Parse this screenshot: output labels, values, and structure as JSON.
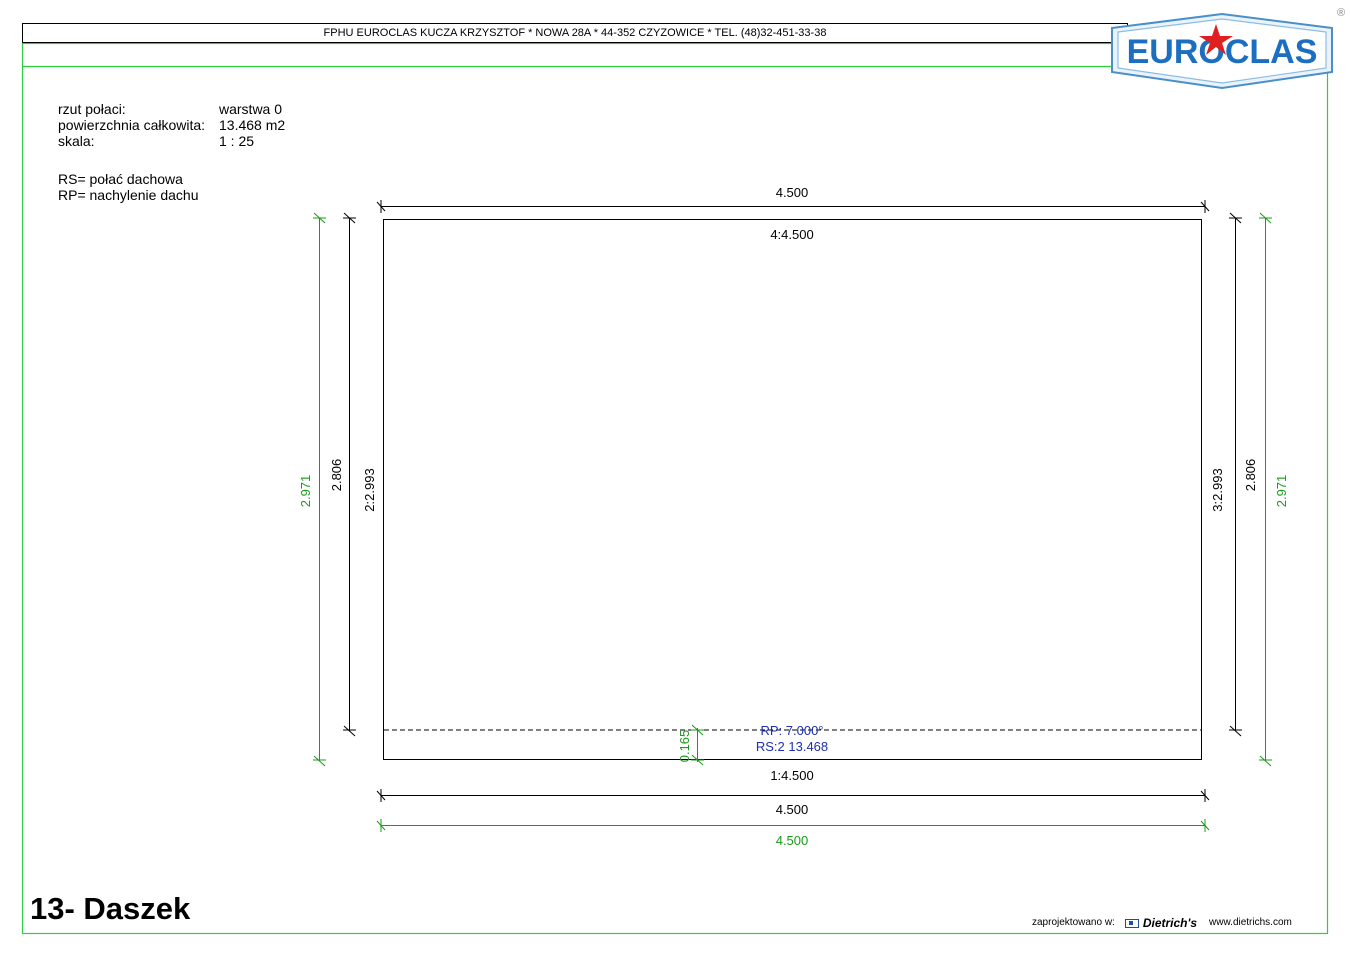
{
  "header": {
    "company_line": "FPHU EUROCLAS KUCZA KRZYSZTOF * NOWA 28A * 44-352 CZYZOWICE * TEL. (48)32-451-33-38",
    "logo_text": "EUROCLAS",
    "registered_mark": "®"
  },
  "info": {
    "rows": [
      {
        "label": "rzut połaci:",
        "value": "warstwa 0"
      },
      {
        "label": "powierzchnia całkowita:",
        "value": "13.468 m2"
      },
      {
        "label": "skala:",
        "value": "1 : 25"
      }
    ]
  },
  "legend": {
    "rs": "RS= połać dachowa",
    "rp": "RP= nachylenie dachu"
  },
  "drawing": {
    "dim_top_overall": "4.500",
    "edge_top": "4:4.500",
    "edge_bottom": "1:4.500",
    "dim_bottom_overall": "4.500",
    "dim_bottom_green": "4.500",
    "dim_left_green": "2.971",
    "dim_left_black": "2.806",
    "edge_left": "2:2.993",
    "edge_right": "3:2.993",
    "dim_right_black": "2.806",
    "dim_right_green": "2.971",
    "overhang": "0.165",
    "rp_label": "RP:  7.000°",
    "rs_label": "RS:2  13.468",
    "colors": {
      "frame_green": "#2ecc40",
      "dim_green": "#1a9a1a",
      "roof_blue": "#1f2fb0"
    }
  },
  "title": "13- Daszek",
  "footer": {
    "designed_in": "zaprojektowano w:",
    "brand": "Dietrich's",
    "url": "www.dietrichs.com"
  }
}
